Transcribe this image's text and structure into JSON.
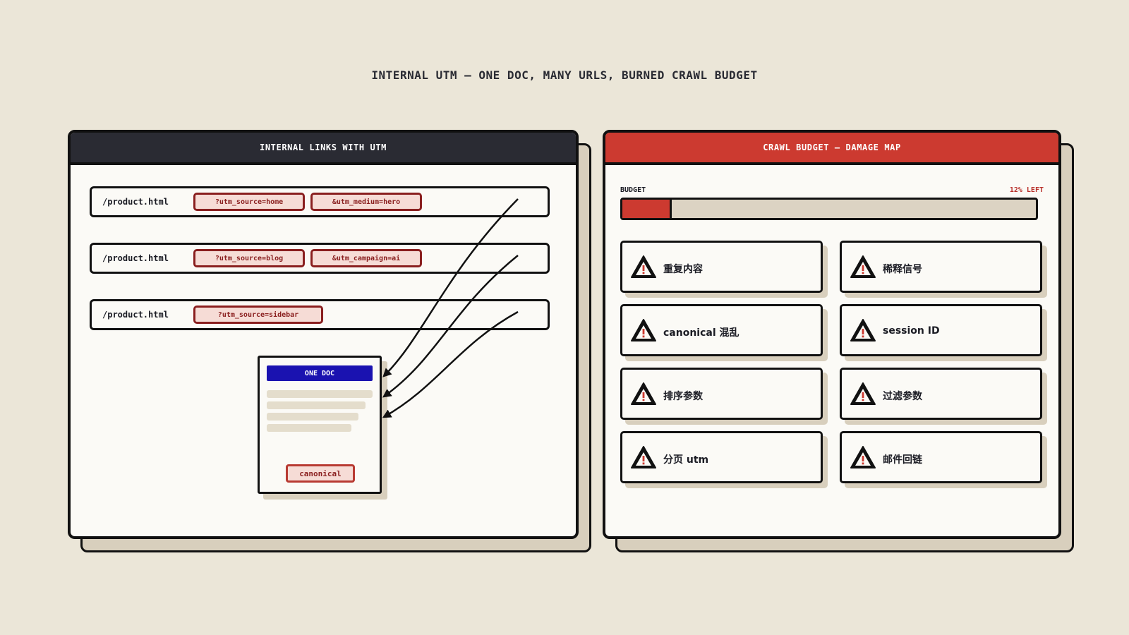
{
  "title": "INTERNAL UTM — ONE DOC, MANY URLS, BURNED CRAWL BUDGET",
  "left_panel": {
    "header": "INTERNAL LINKS WITH UTM",
    "rows": [
      {
        "path": "/product.html",
        "params": [
          "?utm_source=home",
          "&utm_medium=hero"
        ]
      },
      {
        "path": "/product.html",
        "params": [
          "?utm_source=blog",
          "&utm_campaign=ai"
        ]
      },
      {
        "path": "/product.html",
        "params": [
          "?utm_source=sidebar"
        ]
      }
    ],
    "doc": {
      "label": "ONE DOC",
      "canonical": "canonical"
    }
  },
  "right_panel": {
    "header": "CRAWL BUDGET — DAMAGE MAP",
    "budget": {
      "label": "BUDGET",
      "remaining_text": "12% LEFT",
      "remaining_fraction": 0.12
    },
    "damage_items": [
      {
        "label": "重复内容"
      },
      {
        "label": "稀释信号"
      },
      {
        "label": "canonical 混乱"
      },
      {
        "label": "session ID"
      },
      {
        "label": "排序参数"
      },
      {
        "label": "过滤参数"
      },
      {
        "label": "分页 utm"
      },
      {
        "label": "邮件回链"
      }
    ]
  },
  "colors": {
    "background": "#ebe6d8",
    "dark_header": "#2a2b33",
    "red_header": "#cc3a30",
    "doc_blue": "#1a12b0",
    "chip_border": "#8a1f1f"
  }
}
